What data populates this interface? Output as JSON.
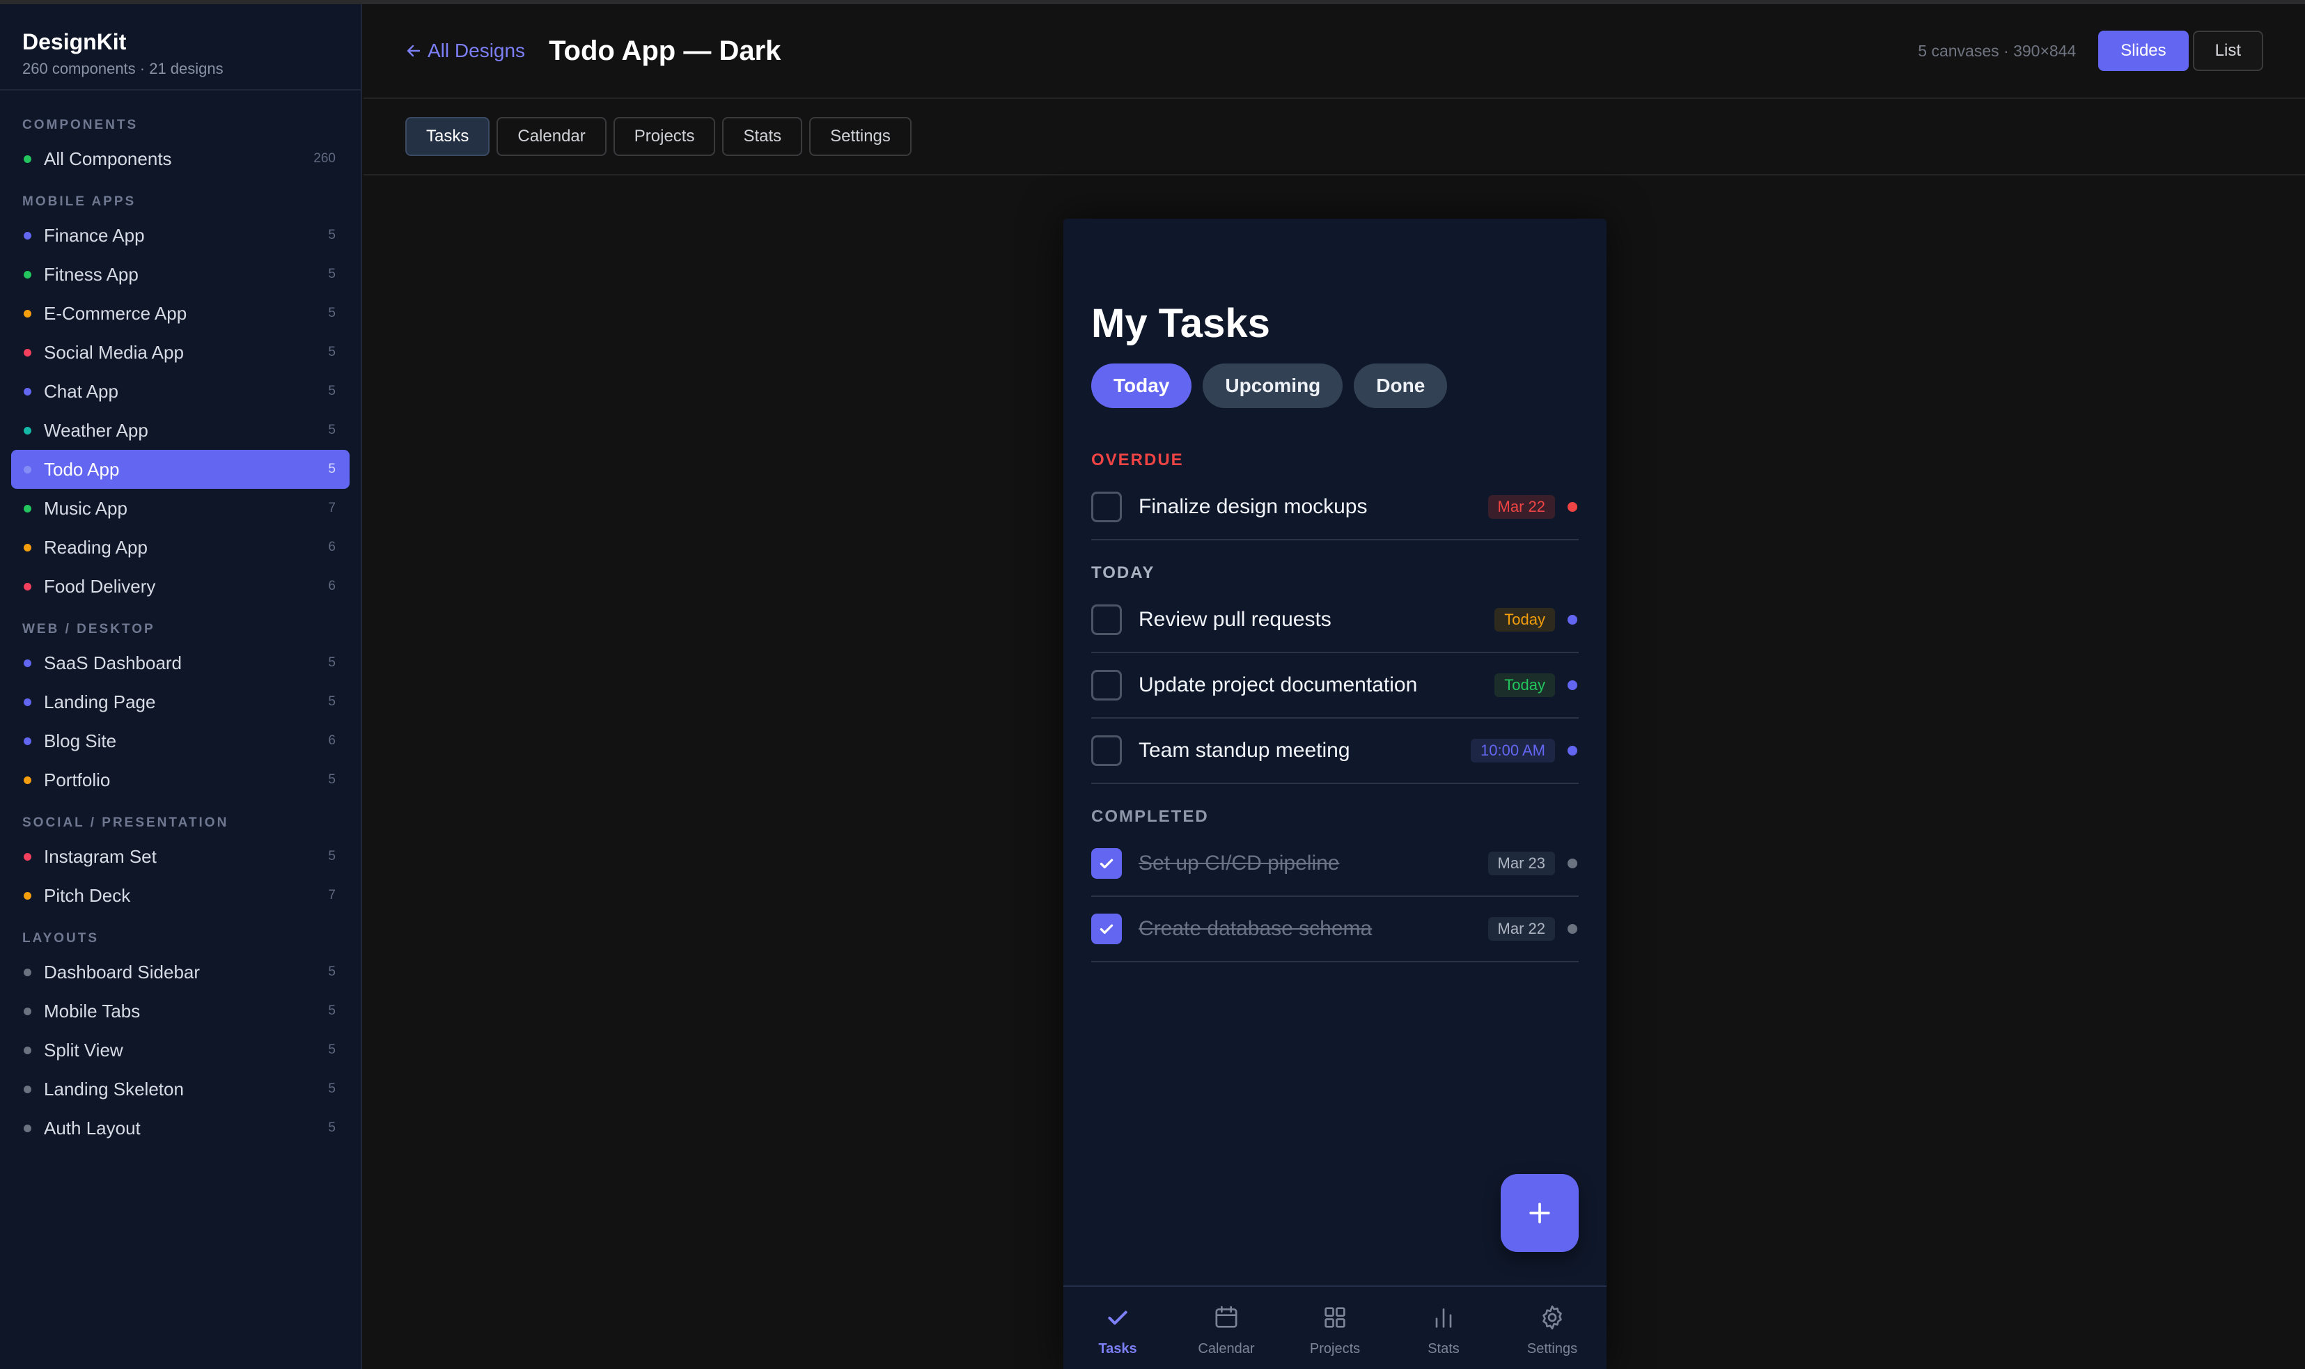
{
  "sidebar": {
    "brand": "DesignKit",
    "subtitle": "260 components · 21 designs",
    "groups": [
      {
        "label": "COMPONENTS",
        "items": [
          {
            "label": "All Components",
            "count": "260",
            "color": "#22c55e"
          }
        ]
      },
      {
        "label": "MOBILE APPS",
        "items": [
          {
            "label": "Finance App",
            "count": "5",
            "color": "#6366f1"
          },
          {
            "label": "Fitness App",
            "count": "5",
            "color": "#22c55e"
          },
          {
            "label": "E-Commerce App",
            "count": "5",
            "color": "#f59e0b"
          },
          {
            "label": "Social Media App",
            "count": "5",
            "color": "#f43f5e"
          },
          {
            "label": "Chat App",
            "count": "5",
            "color": "#6366f1"
          },
          {
            "label": "Weather App",
            "count": "5",
            "color": "#14b8a6"
          },
          {
            "label": "Todo App",
            "count": "5",
            "color": "#a5b4fc"
          },
          {
            "label": "Music App",
            "count": "7",
            "color": "#22c55e"
          },
          {
            "label": "Reading App",
            "count": "6",
            "color": "#f59e0b"
          },
          {
            "label": "Food Delivery",
            "count": "6",
            "color": "#f43f5e"
          }
        ]
      },
      {
        "label": "WEB / DESKTOP",
        "items": [
          {
            "label": "SaaS Dashboard",
            "count": "5",
            "color": "#6366f1"
          },
          {
            "label": "Landing Page",
            "count": "5",
            "color": "#6366f1"
          },
          {
            "label": "Blog Site",
            "count": "6",
            "color": "#6366f1"
          },
          {
            "label": "Portfolio",
            "count": "5",
            "color": "#f59e0b"
          }
        ]
      },
      {
        "label": "SOCIAL / PRESENTATION",
        "items": [
          {
            "label": "Instagram Set",
            "count": "5",
            "color": "#f43f5e"
          },
          {
            "label": "Pitch Deck",
            "count": "7",
            "color": "#f59e0b"
          }
        ]
      },
      {
        "label": "LAYOUTS",
        "items": [
          {
            "label": "Dashboard Sidebar",
            "count": "5",
            "color": "#6b7280"
          },
          {
            "label": "Mobile Tabs",
            "count": "5",
            "color": "#6b7280"
          },
          {
            "label": "Split View",
            "count": "5",
            "color": "#6b7280"
          },
          {
            "label": "Landing Skeleton",
            "count": "5",
            "color": "#6b7280"
          },
          {
            "label": "Auth Layout",
            "count": "5",
            "color": "#6b7280"
          }
        ]
      }
    ],
    "active_item": "Todo App"
  },
  "header": {
    "back_label": "All Designs",
    "title": "Todo App — Dark",
    "canvas_info": "5 canvases · 390×844",
    "slides_label": "Slides",
    "list_label": "List"
  },
  "tabs": [
    "Tasks",
    "Calendar",
    "Projects",
    "Stats",
    "Settings"
  ],
  "active_tab": "Tasks",
  "phone": {
    "title": "My Tasks",
    "filters": [
      "Today",
      "Upcoming",
      "Done"
    ],
    "active_filter": "Today",
    "sections": [
      {
        "label": "OVERDUE",
        "kind": "overdue",
        "tasks": [
          {
            "title": "Finalize design mockups",
            "badge": "Mar 22",
            "badge_color": "#ef4444",
            "badge_bg": "#3a1f2a",
            "dot": "#ef4444",
            "done": false
          }
        ]
      },
      {
        "label": "TODAY",
        "kind": "today",
        "tasks": [
          {
            "title": "Review pull requests",
            "badge": "Today",
            "badge_color": "#f59e0b",
            "badge_bg": "#2e2a1e",
            "dot": "#6366f1",
            "done": false
          },
          {
            "title": "Update project documentation",
            "badge": "Today",
            "badge_color": "#22c55e",
            "badge_bg": "#1b2e2a",
            "dot": "#6366f1",
            "done": false
          },
          {
            "title": "Team standup meeting",
            "badge": "10:00 AM",
            "badge_color": "#6366f1",
            "badge_bg": "#1e2645",
            "dot": "#6366f1",
            "done": false
          }
        ]
      },
      {
        "label": "COMPLETED",
        "kind": "completed",
        "tasks": [
          {
            "title": "Set up CI/CD pipeline",
            "badge": "Mar 23",
            "badge_color": "#aeb5c2",
            "badge_bg": "#1e293b",
            "dot": "#6b7280",
            "done": true
          },
          {
            "title": "Create database schema",
            "badge": "Mar 22",
            "badge_color": "#aeb5c2",
            "badge_bg": "#1e293b",
            "dot": "#6b7280",
            "done": true
          }
        ]
      }
    ],
    "bottom_nav": [
      {
        "label": "Tasks",
        "icon": "check-icon"
      },
      {
        "label": "Calendar",
        "icon": "calendar-icon"
      },
      {
        "label": "Projects",
        "icon": "grid-icon"
      },
      {
        "label": "Stats",
        "icon": "bar-chart-icon"
      },
      {
        "label": "Settings",
        "icon": "gear-icon"
      }
    ],
    "active_nav": "Tasks"
  },
  "colors": {
    "accent": "#6366f1",
    "phone_bg": "#0f172a",
    "sidebar_bg": "#0e1627"
  }
}
